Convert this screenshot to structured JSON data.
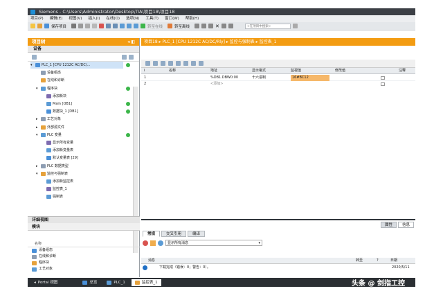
{
  "window": {
    "title": "Siemens  -  C:\\Users\\Administrator\\Desktop\\TIA\\项目18\\项目18",
    "menu": [
      "项目(P)",
      "编辑(E)",
      "视图(V)",
      "插入(I)",
      "在线(O)",
      "选项(N)",
      "工具(T)",
      "窗口(W)",
      "帮助(H)"
    ]
  },
  "toolbar": {
    "save_label": "保存项目",
    "online_label": "转至在线",
    "offline_label": "转至离线",
    "search_placeholder": "<在项目中搜索>"
  },
  "project_tree": {
    "title": "项目树",
    "devices_tab": "设备",
    "items": [
      {
        "label": "PLC_1 [CPU 1212C AC/DC/...",
        "level": 1,
        "status": "ok"
      },
      {
        "label": "设备组态",
        "level": 2,
        "status": ""
      },
      {
        "label": "在线和诊断",
        "level": 2,
        "status": ""
      },
      {
        "label": "程序块",
        "level": 2,
        "status": "ok"
      },
      {
        "label": "添加新块",
        "level": 3,
        "status": ""
      },
      {
        "label": "Main [OB1]",
        "level": 3,
        "status": "ok"
      },
      {
        "label": "数据块_1 [DB1]",
        "level": 3,
        "status": "ok"
      },
      {
        "label": "工艺对象",
        "level": 2,
        "status": ""
      },
      {
        "label": "外部源文件",
        "level": 2,
        "status": ""
      },
      {
        "label": "PLC 变量",
        "level": 2,
        "status": "ok"
      },
      {
        "label": "显示所有变量",
        "level": 3,
        "status": ""
      },
      {
        "label": "添加新变量表",
        "level": 3,
        "status": ""
      },
      {
        "label": "默认变量表 [29]",
        "level": 3,
        "status": ""
      },
      {
        "label": "PLC 数据类型",
        "level": 2,
        "status": ""
      },
      {
        "label": "监控与强制表",
        "level": 2,
        "status": ""
      },
      {
        "label": "添加新监控表",
        "level": 3,
        "status": ""
      },
      {
        "label": "监控表_1",
        "level": 3,
        "status": ""
      },
      {
        "label": "强制表",
        "level": 3,
        "status": ""
      }
    ]
  },
  "details": {
    "title": "详细视图",
    "tab": "模块",
    "column": "名称",
    "items": [
      "设备组态",
      "在线和诊断",
      "程序块",
      "工艺对象"
    ]
  },
  "editor": {
    "breadcrumb": "项目18 ▸ PLC_1 [CPU 1212C AC/DC/Rly] ▸ 监控与强制表 ▸ 监控表_1",
    "columns": [
      "i",
      "名称",
      "地址",
      "显示格式",
      "监视值",
      "修改值",
      "",
      "注释"
    ],
    "rows": [
      {
        "num": "1",
        "name": "",
        "address": "%DB1.DBW0:00",
        "format": "十六进制",
        "monitor": "16#BC12",
        "modify": ""
      },
      {
        "num": "2",
        "name": "",
        "address": "<添加>",
        "format": "",
        "monitor": "",
        "modify": ""
      }
    ]
  },
  "inspector": {
    "tabs": [
      "属性",
      "信息"
    ],
    "info_tabs": [
      "常规",
      "交叉引用",
      "编译"
    ],
    "filter_value": "显示所有消息",
    "columns": [
      "消息",
      "转至",
      "?",
      "日期"
    ],
    "messages": [
      {
        "text": "下载完成（错误：0；警告：0）。",
        "date": "2020/5/11"
      }
    ]
  },
  "taskbar": {
    "portal": "Portal 视图",
    "tasks": [
      "总览",
      "PLC_1",
      "监控表_1"
    ]
  },
  "watermark": "头条 @ 剑指工控",
  "colors": {
    "accent": "#f39c12",
    "status_ok": "#3cb64a",
    "monitor_value_bg": "#f6b86a"
  }
}
